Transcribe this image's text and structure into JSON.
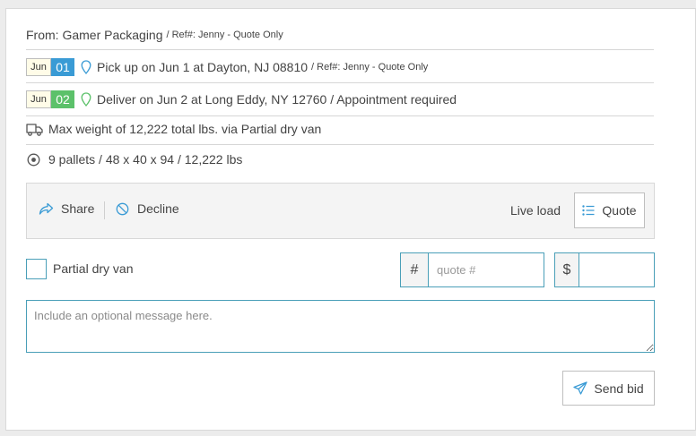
{
  "header": {
    "from_label": "From: Gamer Packaging",
    "ref_label": "/ Ref#: Jenny - Quote Only"
  },
  "pickup": {
    "month": "Jun",
    "day": "01",
    "day_color": "#3a9bd5",
    "text": "Pick up on Jun 1 at Dayton, NJ 08810",
    "ref": "/ Ref#: Jenny - Quote Only",
    "icon": "map-pin-icon"
  },
  "delivery": {
    "month": "Jun",
    "day": "02",
    "day_color": "#5cc16a",
    "text": "Deliver on Jun 2 at Long Eddy, NY 12760 / Appointment required",
    "icon": "map-pin-icon"
  },
  "weight": {
    "text": "Max weight of 12,222 total lbs. via Partial dry van",
    "icon": "truck-icon"
  },
  "pallets": {
    "text": "9 pallets / 48 x 40 x 94 / 12,222 lbs",
    "icon": "target-icon"
  },
  "actions": {
    "share_label": "Share",
    "decline_label": "Decline",
    "live_load_label": "Live load",
    "quote_label": "Quote"
  },
  "form": {
    "equipment_label": "Partial dry van",
    "hash_symbol": "#",
    "quote_placeholder": "quote #",
    "dollar_symbol": "$",
    "amount_value": "",
    "message_placeholder": "Include an optional message here.",
    "send_label": "Send bid"
  },
  "colors": {
    "accent": "#4a9fb8",
    "pickup_badge": "#3a9bd5",
    "delivery_badge": "#5cc16a"
  }
}
